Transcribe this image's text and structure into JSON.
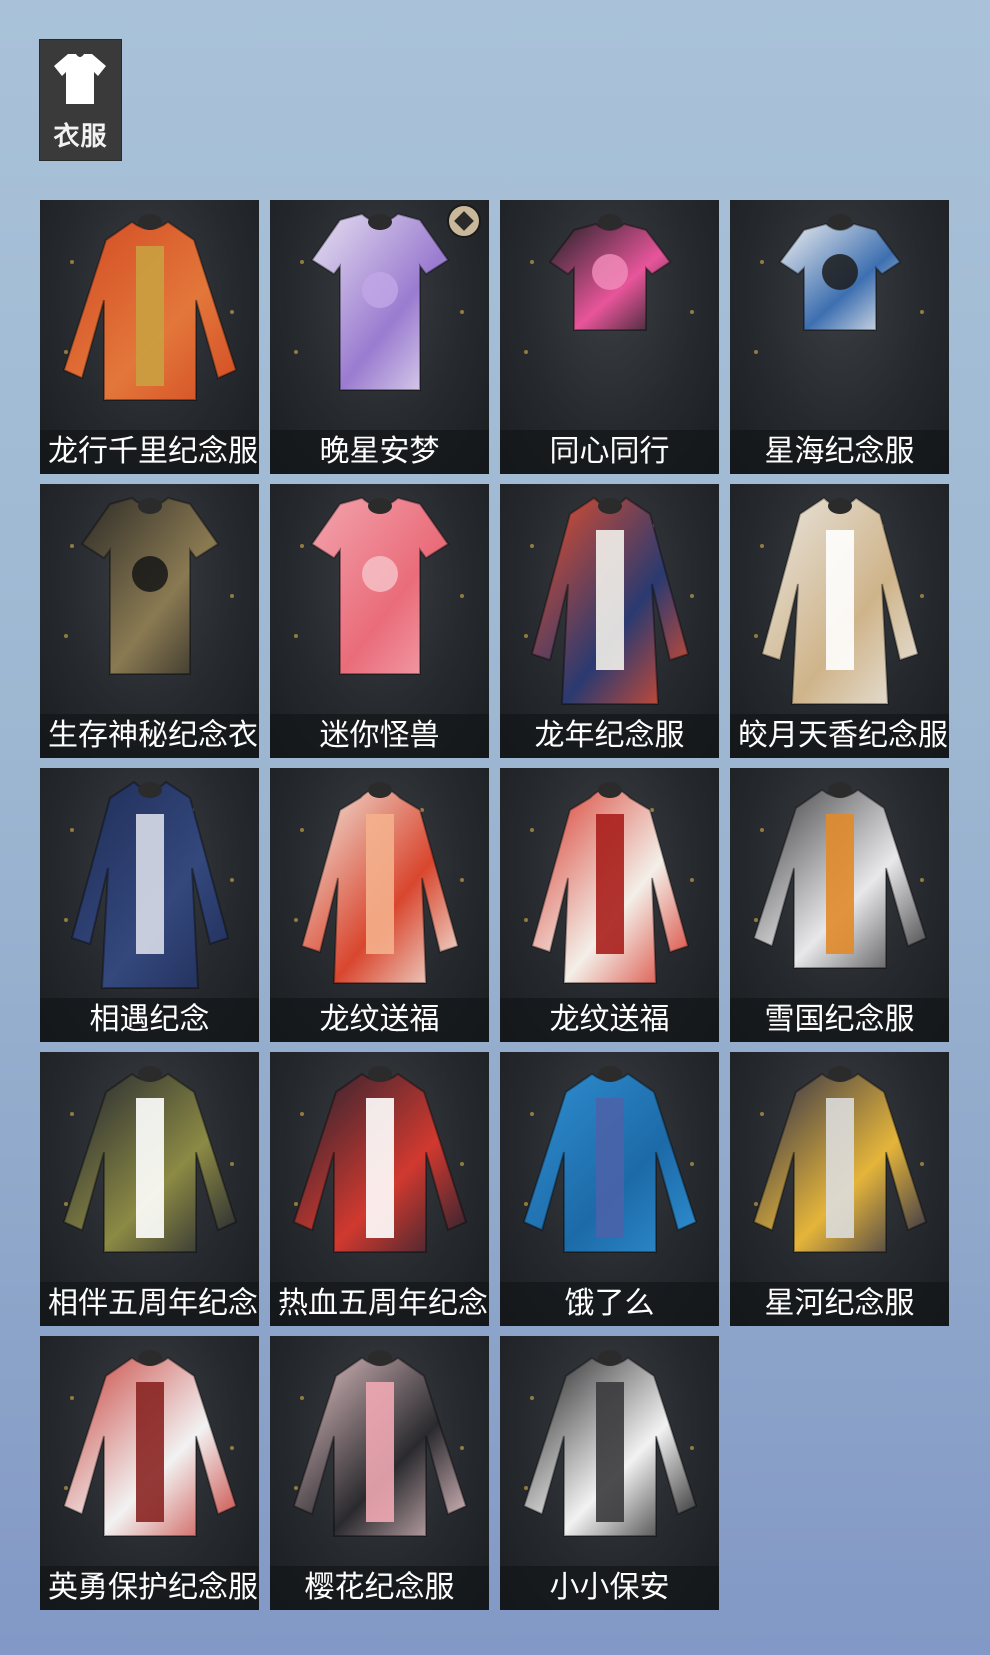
{
  "category_tab": {
    "label": "衣服",
    "icon": "tshirt-icon"
  },
  "items": [
    {
      "name": "龙行千里纪念服",
      "colors": [
        "#d24a24",
        "#e3773a",
        "#caa040"
      ],
      "style": "jacket",
      "clip": true
    },
    {
      "name": "晚星安梦",
      "colors": [
        "#e6e0f0",
        "#9a7bd0",
        "#bfa6e6"
      ],
      "style": "tee",
      "badge": true
    },
    {
      "name": "同心同行",
      "colors": [
        "#222226",
        "#e8559a",
        "#f08ab8"
      ],
      "style": "crop"
    },
    {
      "name": "星海纪念服",
      "colors": [
        "#f0f0f0",
        "#3d6fb0",
        "#1c1c1c"
      ],
      "style": "crop"
    },
    {
      "name": "生存神秘纪念衣",
      "colors": [
        "#2e2c28",
        "#8a7a52",
        "#161616"
      ],
      "style": "tee",
      "clip": true
    },
    {
      "name": "迷你怪兽",
      "colors": [
        "#f2a4ad",
        "#ea6c7a",
        "#f6c0c6"
      ],
      "style": "tee"
    },
    {
      "name": "龙年纪念服",
      "colors": [
        "#e94e2a",
        "#2a3a70",
        "#f2f0ea"
      ],
      "style": "coat"
    },
    {
      "name": "皎月天香纪念服",
      "colors": [
        "#e9e6e0",
        "#cfb48a",
        "#ffffff"
      ],
      "style": "coat",
      "clip": true
    },
    {
      "name": "相遇纪念",
      "colors": [
        "#1f2d57",
        "#34487d",
        "#d8dce8"
      ],
      "style": "coat"
    },
    {
      "name": "龙纹送福",
      "colors": [
        "#f1ede4",
        "#d9462e",
        "#f4b08c"
      ],
      "style": "parka"
    },
    {
      "name": "龙纹送福",
      "colors": [
        "#d8372b",
        "#f3efe8",
        "#a91f1c"
      ],
      "style": "parka"
    },
    {
      "name": "雪国纪念服",
      "colors": [
        "#3a3a3c",
        "#e8e8ea",
        "#e08a2a"
      ],
      "style": "jacket"
    },
    {
      "name": "相伴五周年纪念服",
      "colors": [
        "#1f2230",
        "#8c8a44",
        "#ffffff"
      ],
      "style": "jacket",
      "clip": true
    },
    {
      "name": "热血五周年纪念服",
      "colors": [
        "#202230",
        "#d1392f",
        "#ffffff"
      ],
      "style": "jacket",
      "clip": true
    },
    {
      "name": "饿了么",
      "colors": [
        "#2f8fd1",
        "#1d6aa8",
        "#4a63a8"
      ],
      "style": "jacket"
    },
    {
      "name": "星河纪念服",
      "colors": [
        "#26294a",
        "#e5b53a",
        "#dcdcdc"
      ],
      "style": "jacket"
    },
    {
      "name": "英勇保护纪念服",
      "colors": [
        "#c8403a",
        "#f2f2f2",
        "#8a2522"
      ],
      "style": "jacket",
      "clip": true
    },
    {
      "name": "樱花纪念服",
      "colors": [
        "#e6c5c8",
        "#2a2a2e",
        "#f0a8b4"
      ],
      "style": "jacket"
    },
    {
      "name": "小小保安",
      "colors": [
        "#1e1e20",
        "#f2f2f2",
        "#3a3a3c"
      ],
      "style": "jacket"
    }
  ]
}
